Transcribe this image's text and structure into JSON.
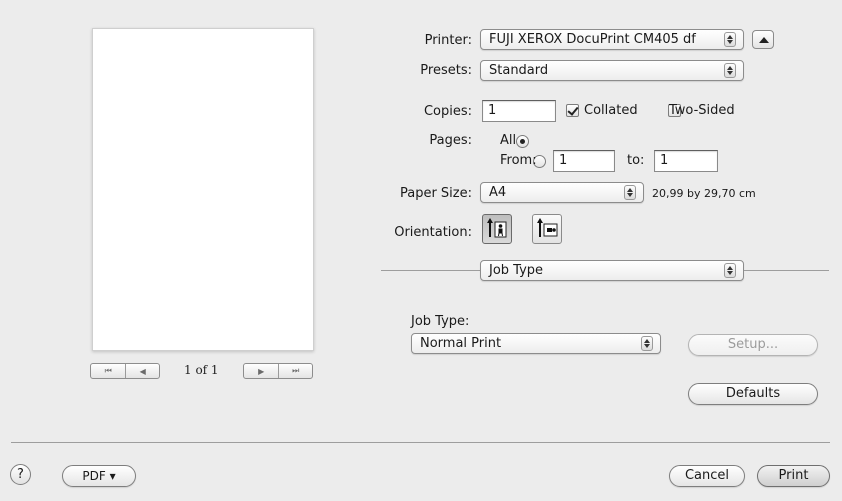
{
  "preview": {
    "first_glyph": "⏮",
    "prev_glyph": "◀",
    "page_indicator": "1 of 1",
    "next_glyph": "▶",
    "last_glyph": "⏭"
  },
  "printer": {
    "label": "Printer:",
    "value": "FUJI XEROX DocuPrint CM405 df"
  },
  "presets": {
    "label": "Presets:",
    "value": "Standard"
  },
  "copies": {
    "label": "Copies:",
    "value": "1",
    "collated_label": "Collated",
    "collated": true,
    "two_sided_label": "Two-Sided",
    "two_sided": false
  },
  "pages": {
    "label": "Pages:",
    "all_label": "All",
    "from_label": "From:",
    "from_value": "1",
    "to_label": "to:",
    "to_value": "1",
    "selected": "All"
  },
  "paper_size": {
    "label": "Paper Size:",
    "value": "A4",
    "dimensions": "20,99 by 29,70 cm"
  },
  "orientation": {
    "label": "Orientation:",
    "selected": "portrait"
  },
  "section_popup": {
    "value": "Job Type"
  },
  "job_type": {
    "label": "Job Type:",
    "value": "Normal Print",
    "setup_label": "Setup...",
    "setup_enabled": false
  },
  "defaults_label": "Defaults",
  "footer": {
    "help_glyph": "?",
    "pdf_label": "PDF ▾",
    "cancel_label": "Cancel",
    "print_label": "Print"
  }
}
